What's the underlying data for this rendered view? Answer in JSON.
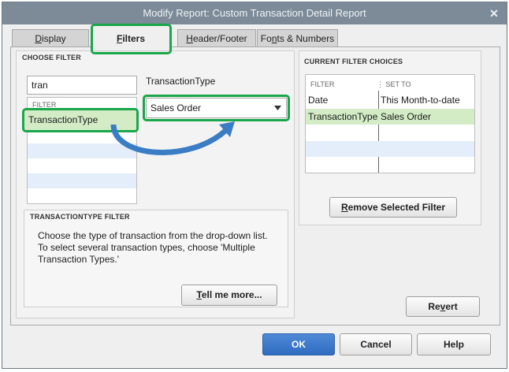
{
  "window": {
    "title": "Modify Report: Custom Transaction Detail Report",
    "close_glyph": "✕"
  },
  "tabs": [
    {
      "label": "Display",
      "underline": "D",
      "rest": "isplay"
    },
    {
      "label": "Filters",
      "underline": "F",
      "rest": "ilters"
    },
    {
      "label": "Header/Footer",
      "underline": "H",
      "rest": "eader/Footer"
    },
    {
      "label": "Fonts & Numbers",
      "pre": "Fo",
      "underline": "n",
      "rest": "ts & Numbers"
    }
  ],
  "choose_filter": {
    "title": "CHOOSE FILTER",
    "search_value": "tran",
    "list_header": "FILTER",
    "selected_item": "TransactionType",
    "field_label": "TransactionType",
    "dropdown_value": "Sales Order"
  },
  "filter_help": {
    "title": "TRANSACTIONTYPE FILTER",
    "description": "Choose the type of transaction from the drop-down list. To select several transaction types, choose 'Multiple Transaction Types.'",
    "tell_me_more": {
      "underline": "T",
      "rest": "ell me more..."
    }
  },
  "current_filters": {
    "title": "CURRENT FILTER CHOICES",
    "col_filter": "FILTER",
    "col_set_to": "SET TO",
    "rows": [
      {
        "filter": "Date",
        "set_to": "This Month-to-date"
      },
      {
        "filter": "TransactionType",
        "set_to": "Sales Order"
      }
    ],
    "remove_button": {
      "underline": "R",
      "rest": "emove Selected Filter"
    }
  },
  "revert_button": {
    "pre": "Re",
    "underline": "v",
    "rest": "ert"
  },
  "footer": {
    "ok": "OK",
    "cancel": "Cancel",
    "help": "Help"
  },
  "colors": {
    "highlight_green": "#1aa64a",
    "selected_row": "#d3ecc6",
    "stripe_blue": "#e4eefa",
    "arrow_blue": "#3b7dc4"
  }
}
